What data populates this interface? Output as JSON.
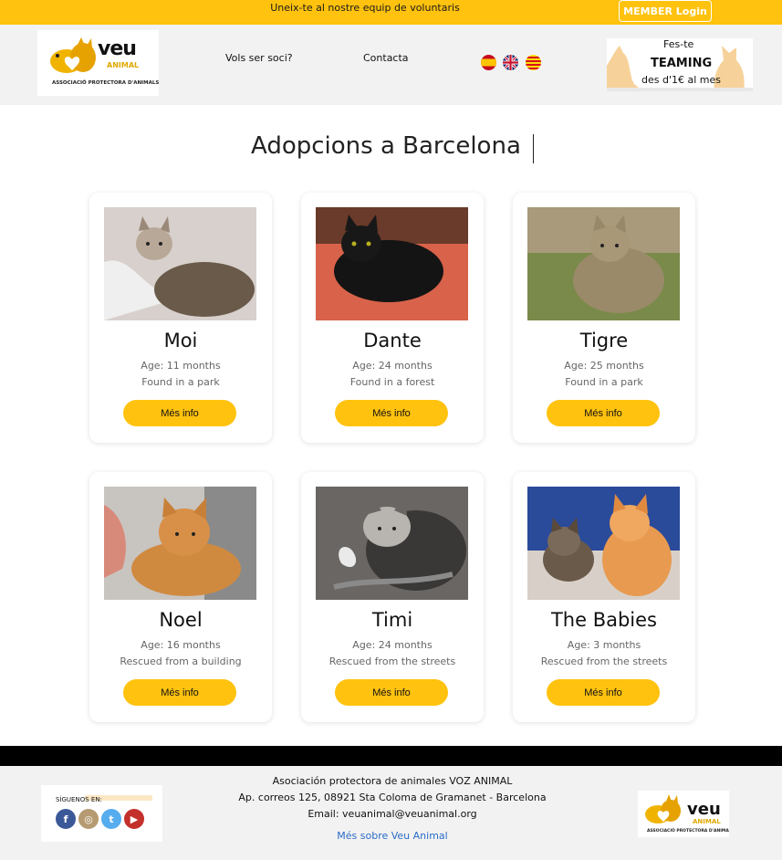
{
  "topbar": {
    "promo": "Uneix-te al nostre equip de voluntaris",
    "member_login": "MEMBER Login"
  },
  "header": {
    "logo": {
      "word": "veu",
      "sub": "ANIMAL",
      "tagline": "ASSOCIACIÓ PROTECTORA D'ANIMALS"
    },
    "nav": {
      "soci": "Vols ser soci?",
      "contacta": "Contacta"
    },
    "languages": [
      "spanish-flag",
      "english-flag",
      "catalan-flag"
    ],
    "teaming": {
      "line1": "Fes-te",
      "line2": "TEAMING",
      "line3": "des d'1€ al mes"
    }
  },
  "main": {
    "title": "Adopcions a Barcelona",
    "cards": [
      {
        "name": "Moi",
        "age": "Age: 11 months",
        "note": "Found in a park",
        "button": "Més info"
      },
      {
        "name": "Dante",
        "age": "Age: 24 months",
        "note": "Found in a forest",
        "button": "Més info"
      },
      {
        "name": "Tigre",
        "age": "Age: 25 months",
        "note": "Found in a park",
        "button": "Més info"
      },
      {
        "name": "Noel",
        "age": "Age: 16 months",
        "note": "Rescued from a building",
        "button": "Més info"
      },
      {
        "name": "Timi",
        "age": "Age: 24 months",
        "note": "Rescued from the streets",
        "button": "Més info"
      },
      {
        "name": "The Babies",
        "age": "Age: 3 months",
        "note": "Rescued from the streets",
        "button": "Més info"
      }
    ]
  },
  "footer": {
    "social_label": "SÍGUENOS EN:",
    "social": [
      "facebook-icon",
      "instagram-icon",
      "twitter-icon",
      "youtube-icon"
    ],
    "line1": "Asociación protectora de animales VOZ ANIMAL",
    "line2": "Ap. correos 125, 08921 Sta Coloma de Gramanet - Barcelona",
    "line3": "Email: veuanimal@veuanimal.org",
    "link": "Més sobre Veu Animal"
  },
  "colors": {
    "accent": "#ffc20e",
    "link": "#2a6cc7",
    "header_bg": "#f2f2f2"
  }
}
